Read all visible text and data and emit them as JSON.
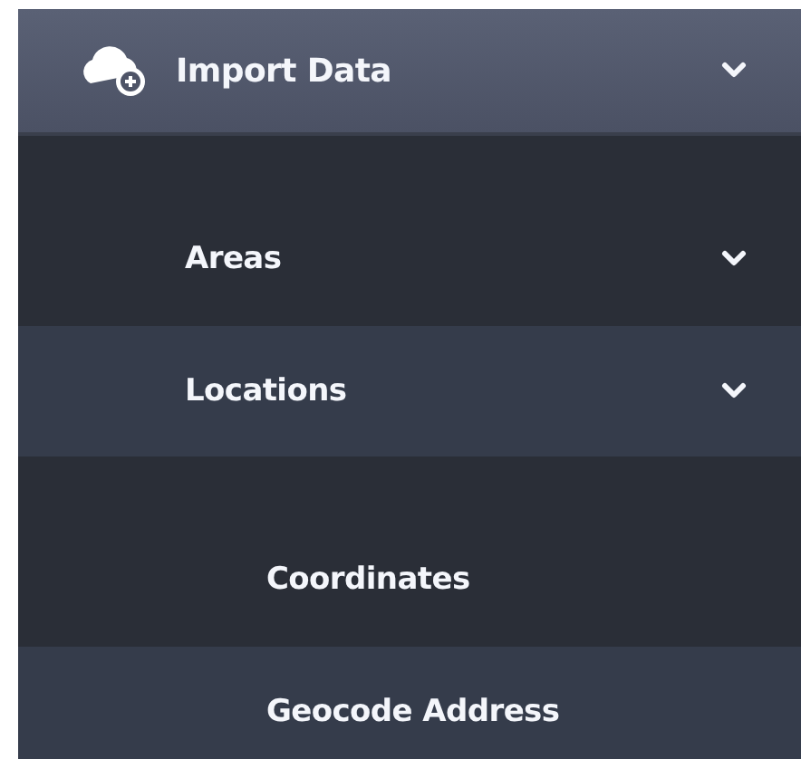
{
  "menu": {
    "label": "Import Data",
    "has_submenu": true,
    "children": [
      {
        "label": "Areas",
        "has_submenu": true
      },
      {
        "label": "Locations",
        "has_submenu": true,
        "children": [
          {
            "label": "Coordinates",
            "has_submenu": false
          },
          {
            "label": "Geocode Address",
            "has_submenu": false
          }
        ]
      }
    ]
  }
}
